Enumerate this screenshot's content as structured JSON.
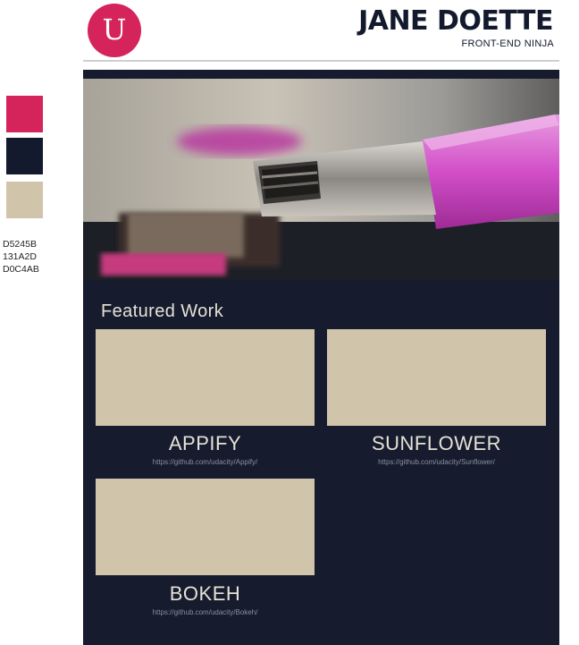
{
  "header": {
    "logo_letter": "U",
    "name": "JANE DOETTE",
    "role": "FRONT-END NINJA"
  },
  "palette": {
    "colors": [
      "#D5245B",
      "#131A2D",
      "#D0C4AB"
    ],
    "labels": [
      "D5245B",
      "131A2D",
      "D0C4AB"
    ]
  },
  "hero": {
    "image": "usb-flash-drive-photo"
  },
  "featured": {
    "title": "Featured Work",
    "projects": [
      {
        "title": "APPIFY",
        "url": "https://github.com/udacity/Appify/"
      },
      {
        "title": "SUNFLOWER",
        "url": "https://github.com/udacity/Sunflower/"
      },
      {
        "title": "BOKEH",
        "url": "https://github.com/udacity/Bokeh/"
      }
    ]
  }
}
